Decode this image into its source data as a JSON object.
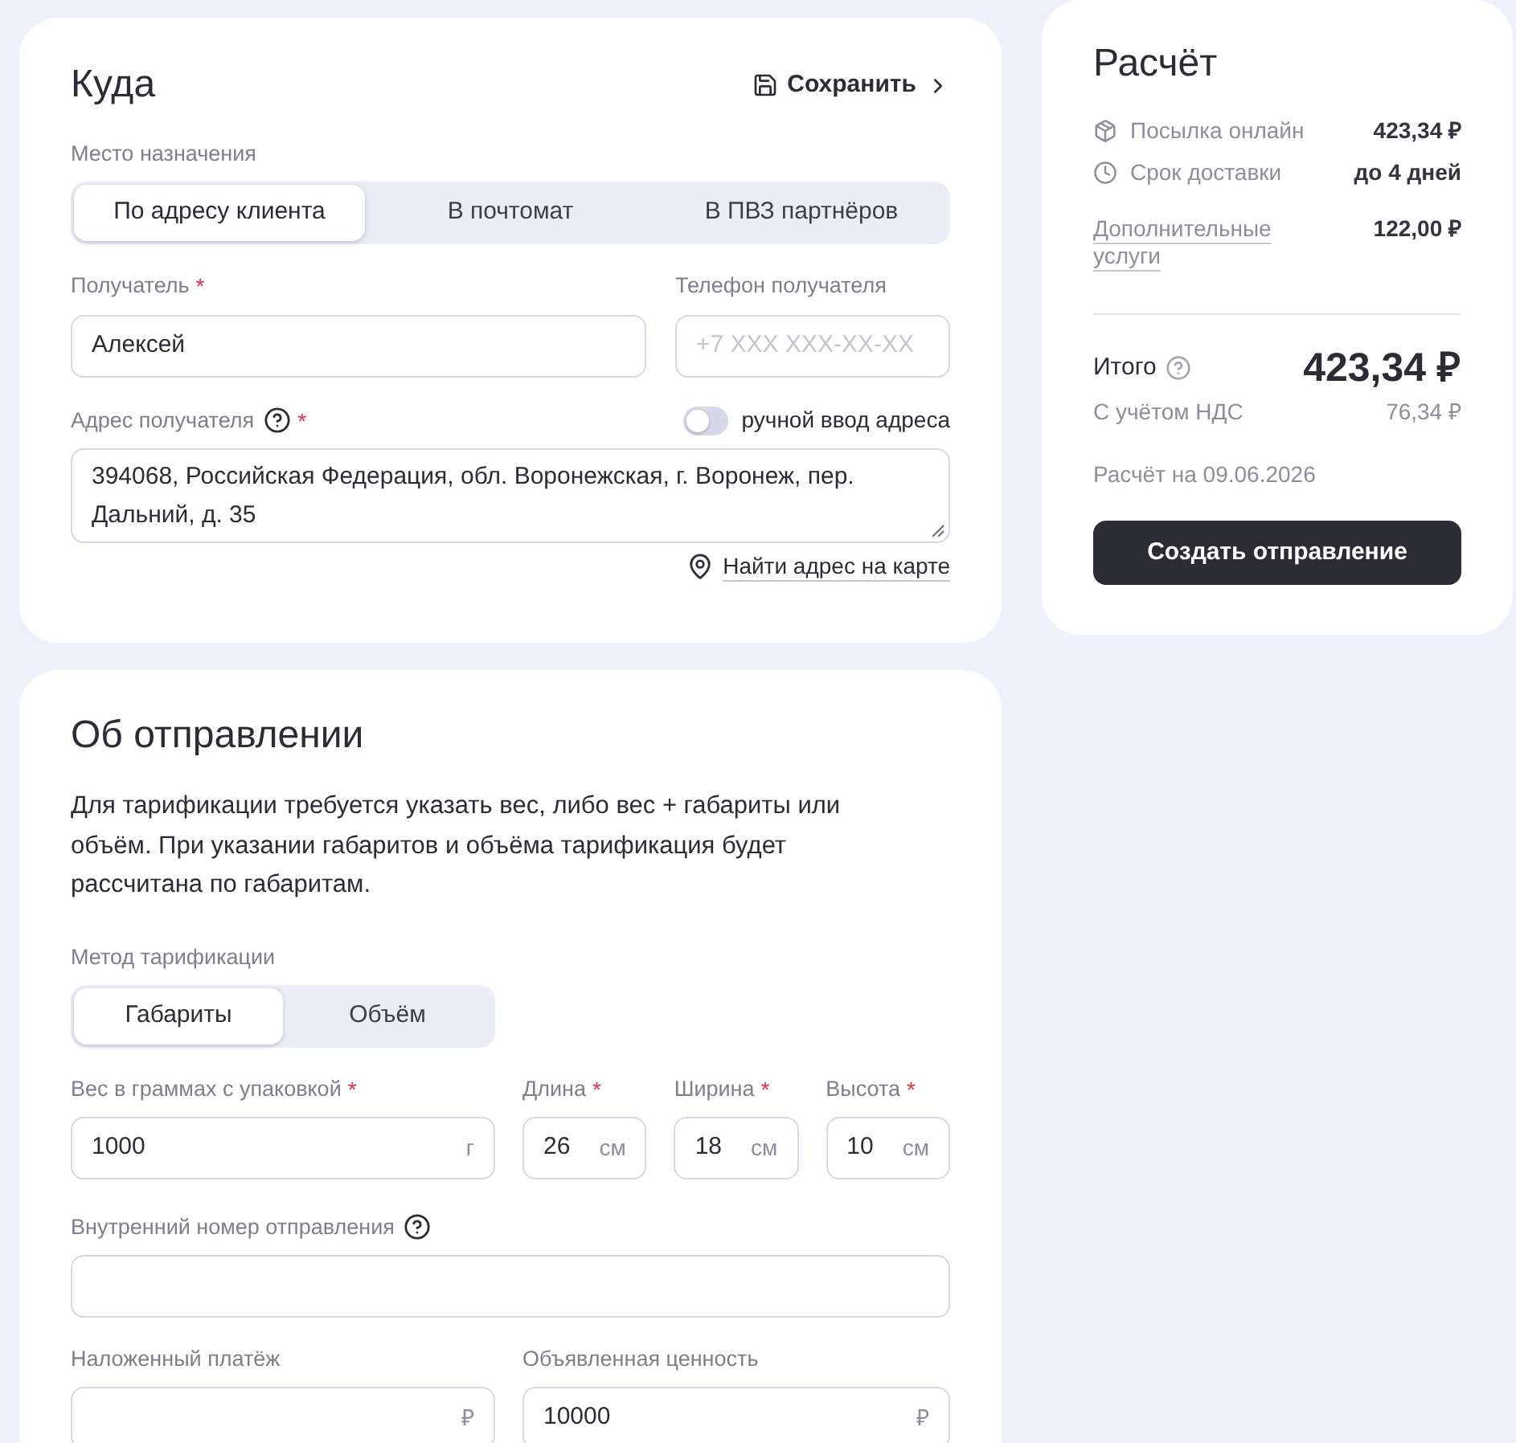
{
  "destination": {
    "title": "Куда",
    "save_link": "Сохранить",
    "place_label": "Место назначения",
    "place_tabs": [
      {
        "label": "По адресу клиента",
        "selected": true
      },
      {
        "label": "В почтомат",
        "selected": false
      },
      {
        "label": "В ПВЗ партнёров",
        "selected": false
      }
    ],
    "recipient": {
      "label": "Получатель",
      "required_mark": "*",
      "value": "Алексей"
    },
    "phone": {
      "label": "Телефон получателя",
      "placeholder": "+7 XXX XXX-XX-XX"
    },
    "address": {
      "label": "Адрес получателя",
      "help_icon": true,
      "required_mark": "*",
      "value": "394068, Российская Федерация, обл. Воронежская, г. Воронеж, пер. Дальний, д. 35"
    },
    "manual_input": {
      "label": "ручной ввод адреса",
      "on": false
    },
    "map_link": "Найти адрес на карте"
  },
  "shipment": {
    "title": "Об отправлении",
    "description": "Для тарификации требуется указать вес, либо вес + габариты или объём. При указании габаритов и объёма тарификация будет рассчитана по габаритам.",
    "method_label": "Метод тарификации",
    "method_tabs": [
      {
        "label": "Габариты",
        "selected": true
      },
      {
        "label": "Объём",
        "selected": false
      }
    ],
    "size_fields": [
      {
        "label": "Вес в граммах с упаковкой",
        "required_mark": "*",
        "value": "1000",
        "unit": "г"
      },
      {
        "label": "Длина",
        "required_mark": "*",
        "value": "26",
        "unit": "см"
      },
      {
        "label": "Ширина",
        "required_mark": "*",
        "value": "18",
        "unit": "см"
      },
      {
        "label": "Высота",
        "required_mark": "*",
        "value": "10",
        "unit": "см"
      }
    ],
    "internal_number": {
      "label": "Внутренний номер отправления",
      "help_icon": true
    },
    "payment_fields": [
      {
        "label": "Наложенный платёж",
        "unit": "₽"
      },
      {
        "label": "Объявленная ценность",
        "value": "10000",
        "unit": "₽"
      }
    ]
  },
  "summary": {
    "title": "Расчёт",
    "rows": [
      {
        "kind": "tariff",
        "label": "Посылка онлайн",
        "value": "423,34 ₽"
      },
      {
        "kind": "term",
        "label": "Срок доставки",
        "value": "до 4 дней"
      },
      {
        "kind": "services",
        "label": "Дополнительные услуги",
        "value": "122,00 ₽"
      }
    ],
    "total": {
      "label": "Итого",
      "help_icon": true,
      "value": "423,34 ₽",
      "vat_label": "С учётом НДС",
      "vat_value": "76,34 ₽"
    },
    "date": "Расчёт на 09.06.2026",
    "button": "Создать отправление"
  }
}
